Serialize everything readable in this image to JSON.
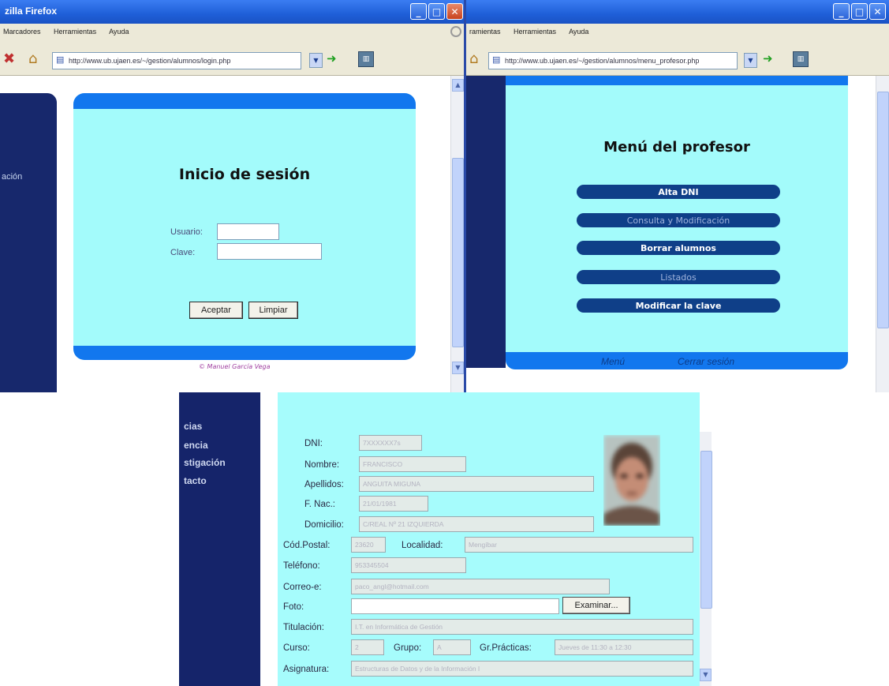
{
  "login_window": {
    "title": "zilla Firefox",
    "menu": [
      "Marcadores",
      "Herramientas",
      "Ayuda"
    ],
    "url": "http://www.ub.ujaen.es/~/gestion/alumnos/login.php",
    "sidebar_word": "ación",
    "heading": "Inicio de sesión",
    "user_label": "Usuario:",
    "password_label": "Clave:",
    "accept_button": "Aceptar",
    "clear_button": "Limpiar",
    "credit": "© Manuel García Vega"
  },
  "menu_window": {
    "menu": [
      "ramientas",
      "Herramientas",
      "Ayuda"
    ],
    "url": "http://www.ub.ujaen.es/~/gestion/alumnos/menu_profesor.php",
    "heading": "Menú del profesor",
    "items": [
      {
        "label": "Alta DNI"
      },
      {
        "label": "Consulta y Modificación"
      },
      {
        "label": "Borrar alumnos"
      },
      {
        "label": "Listados"
      },
      {
        "label": "Modificar la clave"
      }
    ],
    "footer_menu": "Menú",
    "footer_logout": "Cerrar sesión"
  },
  "form_window": {
    "side_links": [
      "cias",
      "encia",
      "stigación",
      "tacto"
    ],
    "labels": {
      "dni": "DNI:",
      "nombre": "Nombre:",
      "apellidos": "Apellidos:",
      "fnac": "F. Nac.:",
      "domicilio": "Domicilio:",
      "cp": "Cód.Postal:",
      "localidad": "Localidad:",
      "telefono": "Teléfono:",
      "correo": "Correo-e:",
      "foto": "Foto:",
      "titulacion": "Titulación:",
      "curso": "Curso:",
      "grupo": "Grupo:",
      "grpracticas": "Gr.Prácticas:",
      "asignatura": "Asignatura:"
    },
    "values": {
      "dni": "7XXXXXX7s",
      "nombre": "FRANCISCO",
      "apellidos": "ANGUITA MIGUNA",
      "fnac": "21/01/1981",
      "domicilio": "C/REAL Nº 21 IZQUIERDA",
      "cp": "23620",
      "localidad": "Mengíbar",
      "telefono": "953345504",
      "correo": "paco_angl@hotmail.com",
      "titulacion": "I.T. en Informática de Gestión",
      "curso": "2",
      "grupo": "A",
      "grpracticas": "Jueves de 11:30 a 12:30",
      "asignatura": "Estructuras de Datos y de la Información I"
    },
    "browse_button": "Examinar..."
  }
}
